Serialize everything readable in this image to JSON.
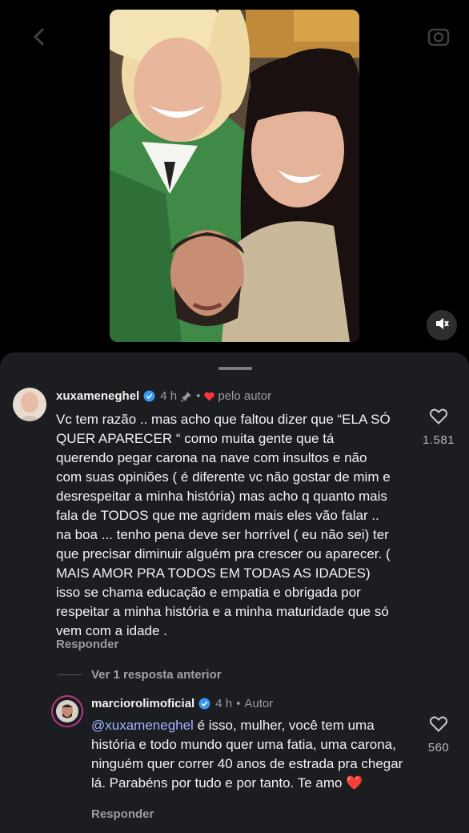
{
  "media": {
    "image": "photo-collage-two-smiling-women-and-man-face-sticker",
    "mute_icon": "speaker-muted-icon"
  },
  "comments": [
    {
      "username": "xuxameneghel",
      "time": "4 h",
      "pin_icon": "pin-icon",
      "liked_by": "pelo autor",
      "text": "Vc tem razão .. mas acho que faltou dizer que “ELA SÓ QUER APARECER “ como muita gente que tá querendo pegar carona na nave com insultos e não com suas opiniões ( é diferente vc não gostar de mim e desrespeitar a minha história) mas acho q quanto mais fala de TODOS que me agridem mais eles vão falar .. na boa ... tenho pena deve ser horrível ( eu não sei) ter que precisar diminuir alguém pra crescer ou aparecer. ( MAIS AMOR PRA TODOS EM TODAS AS IDADES) isso se chama educação e empatia  e obrigada por respeitar a minha história e a minha maturidade que só vem com a idade .",
      "reply_label": "Responder",
      "like_count": "1.581"
    }
  ],
  "view_previous": "Ver 1 resposta anterior",
  "reply": {
    "username": "marciorolimoficial",
    "time": "4 h",
    "author_badge": "Autor",
    "mention": "@xuxameneghel",
    "text": " é isso, mulher, você tem uma história e todo mundo quer uma fatia, uma carona, ninguém quer correr 40 anos de estrada pra chegar lá. Parabéns por tudo e por tanto. Te amo ",
    "emoji": "❤️",
    "reply_label": "Responder",
    "like_count": "560"
  },
  "colors": {
    "sheet_bg": "#1c1d21",
    "verified_blue": "#3897f0",
    "heart_red": "#ff3040",
    "mention_blue": "#9cb4ff"
  }
}
